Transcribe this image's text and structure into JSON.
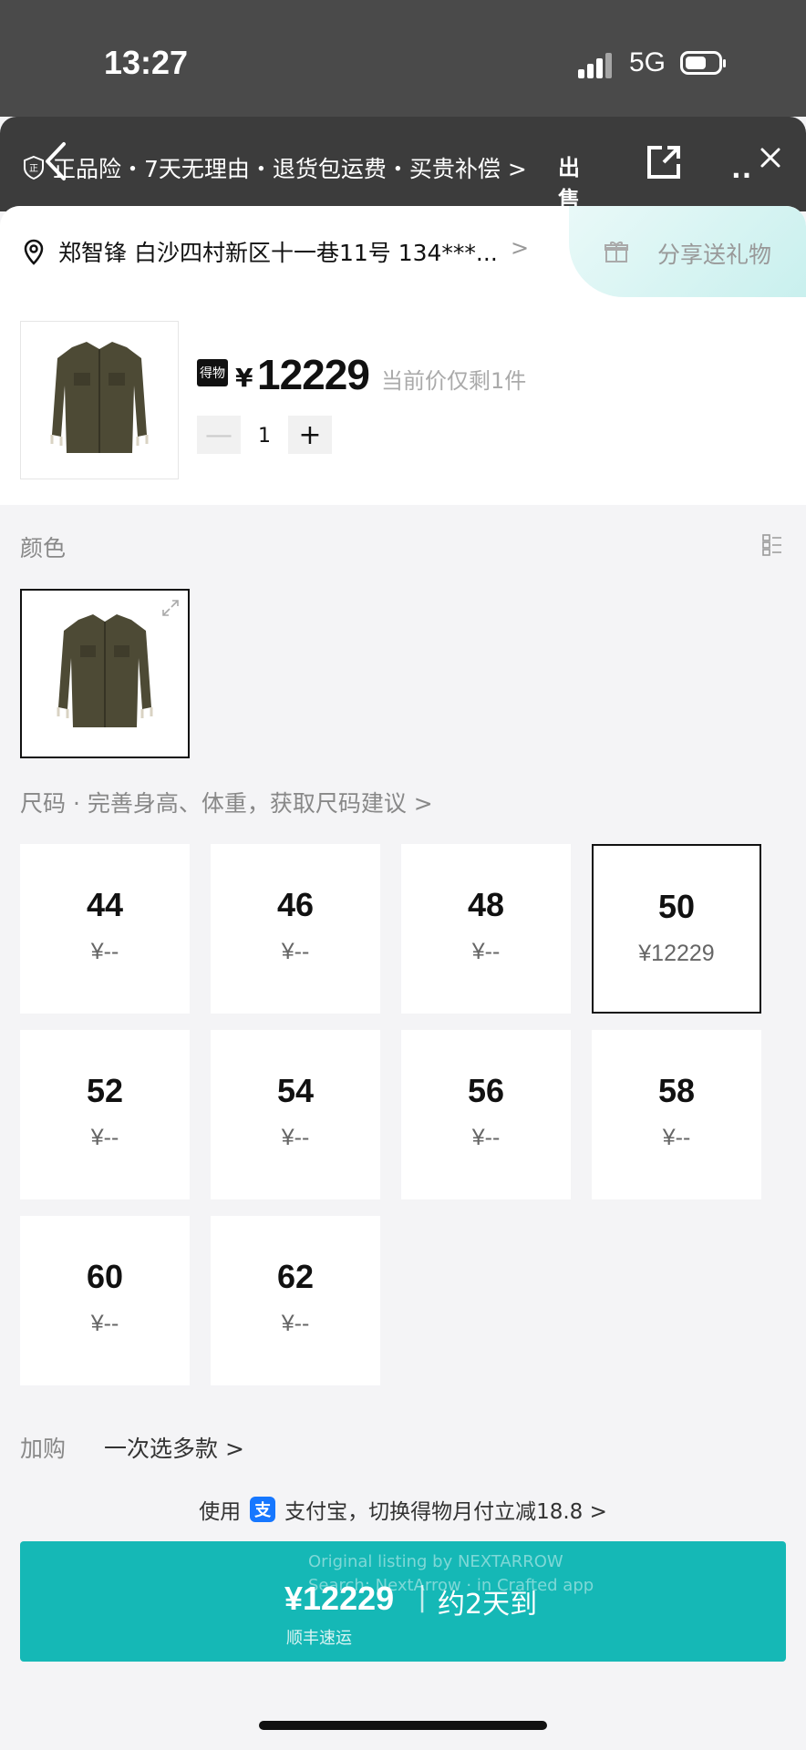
{
  "status_bar": {
    "time": "13:27",
    "network": "5G"
  },
  "top_bar": {
    "guarantee_text": "正品险・7天无理由・退货包运费・买贵补偿 >",
    "sell_label": "出售"
  },
  "address": {
    "text": "郑智锋 白沙四村新区十一巷11号 134***...",
    "chevron": ">",
    "gift_label": "分享送礼物"
  },
  "product": {
    "badge": "得物",
    "currency": "¥",
    "price": "12229",
    "stock_note": "当前价仅剩1件",
    "quantity": "1",
    "minus": "—",
    "plus": "+"
  },
  "color_section": {
    "label": "颜色"
  },
  "size_section": {
    "label": "尺码 · 完善身高、体重，获取尺码建议 >",
    "selected": "50",
    "sizes": [
      {
        "size": "44",
        "price": "¥--"
      },
      {
        "size": "46",
        "price": "¥--"
      },
      {
        "size": "48",
        "price": "¥--"
      },
      {
        "size": "50",
        "price": "¥12229"
      },
      {
        "size": "52",
        "price": "¥--"
      },
      {
        "size": "54",
        "price": "¥--"
      },
      {
        "size": "56",
        "price": "¥--"
      },
      {
        "size": "58",
        "price": "¥--"
      },
      {
        "size": "60",
        "price": "¥--"
      },
      {
        "size": "62",
        "price": "¥--"
      }
    ]
  },
  "addon": {
    "label": "加购",
    "value": "一次选多款 >"
  },
  "payment_promo": {
    "prefix": "使用",
    "alipay_icon": "支",
    "text": "支付宝，切换得物月付立减18.8 >"
  },
  "buy_button": {
    "price": "¥12229",
    "separator": "|",
    "eta": "约2天到",
    "shipping": "顺丰速运",
    "watermark_line1": "Original listing by NEXTARROW",
    "watermark_line2": "Search: NextArrow · in Crafted app"
  },
  "colors": {
    "accent": "#15b8b6",
    "alipay": "#1677ff"
  }
}
